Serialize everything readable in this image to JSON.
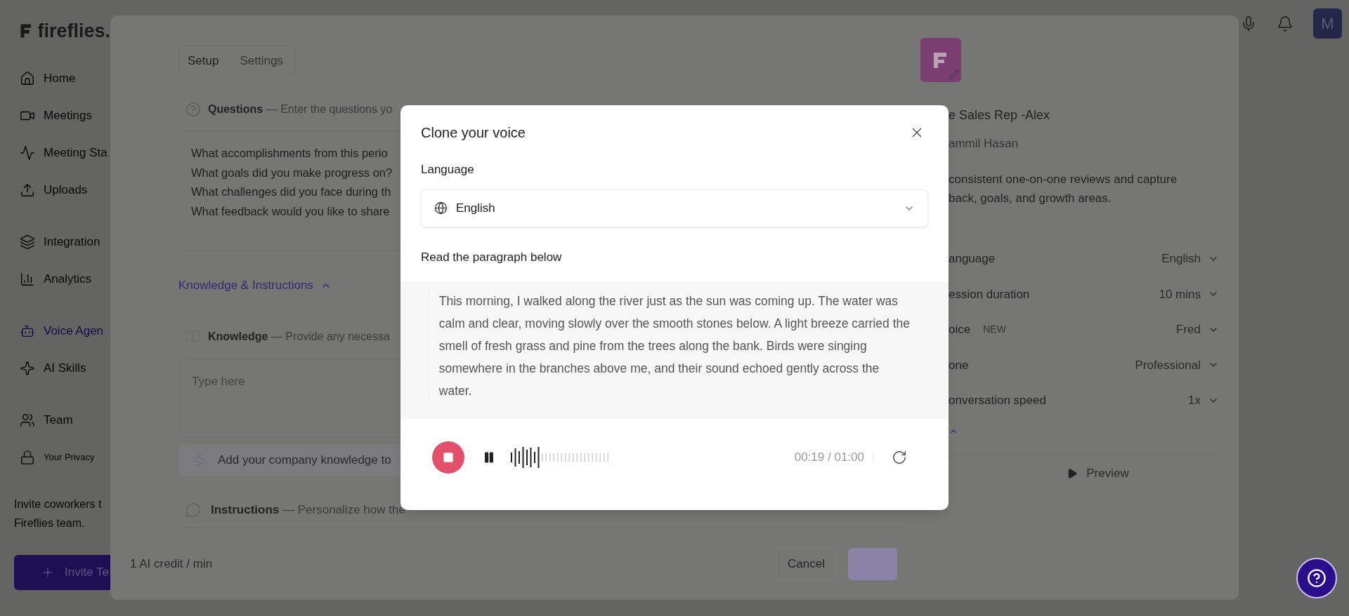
{
  "app": {
    "logo": "fireflies.",
    "sidebar": {
      "groups": [
        [
          {
            "label": "Home",
            "selected": false
          },
          {
            "label": "Meetings",
            "selected": false
          },
          {
            "label": "Meeting Sta",
            "selected": false
          },
          {
            "label": "Uploads",
            "selected": false
          }
        ],
        [
          {
            "label": "Integration",
            "selected": false
          },
          {
            "label": "Analytics",
            "selected": false
          }
        ],
        [
          {
            "label": "Voice Agen",
            "selected": true
          },
          {
            "label": "AI Skills",
            "selected": false
          }
        ],
        [
          {
            "label": "Team",
            "selected": false
          },
          {
            "label": "Your Privacy",
            "selected": false
          }
        ]
      ],
      "invite_text": [
        "Invite coworkers t",
        "Fireflies team."
      ],
      "invite_button": "Invite Te"
    },
    "avatar": "M"
  },
  "agent_editor": {
    "tabs": [
      {
        "label": "Setup",
        "selected": true
      },
      {
        "label": "Settings",
        "selected": false
      }
    ],
    "questions": {
      "title": "Questions",
      "hint": "— Enter the questions yo",
      "lines": [
        "What accomplishments from this perio",
        "What goals did you make progress on?",
        "What challenges did you face during th",
        "What feedback would you like to share"
      ]
    },
    "section_toggle": {
      "label": "Knowledge & Instructions",
      "expanded": true
    },
    "knowledge": {
      "title": "Knowledge",
      "hint": "— Provide any necessa",
      "placeholder": "Type here",
      "tip": "Add your company knowledge to"
    },
    "instructions": {
      "title": "Instructions",
      "hint": "— Personalize how the"
    },
    "footer": {
      "credit": "1 AI credit / min",
      "cancel": "Cancel",
      "save_disabled": true
    },
    "agent": {
      "name": "e Sales Rep -Alex",
      "owner": "ammil Hasan",
      "description": [
        "consistent one-on-one reviews and capture",
        "back, goals, and growth areas."
      ],
      "settings": [
        {
          "label": "anguage",
          "value": "English"
        },
        {
          "label": "ession duration",
          "value": "10 mins"
        },
        {
          "label": "oice",
          "badge": "NEW",
          "value": "Fred"
        },
        {
          "label": "one",
          "value": "Professional"
        },
        {
          "label": "onversation speed",
          "value": "1x"
        }
      ],
      "more_expanded": true,
      "preview": "Preview"
    }
  },
  "dialog": {
    "title": "Clone your voice",
    "language_label": "Language",
    "language": "English",
    "paragraph_label": "Read the paragraph below",
    "paragraph": "This morning, I walked along the river just as the sun was coming up. The water was calm and clear, moving slowly over the smooth stones below. A light breeze carried the smell of fresh grass and pine from the trees along the bank. Birds were singing somewhere in the branches above me, and their sound echoed gently across the water.",
    "recording": true,
    "paused": false,
    "level": 0.32,
    "time": "00:19 / 01:00"
  }
}
